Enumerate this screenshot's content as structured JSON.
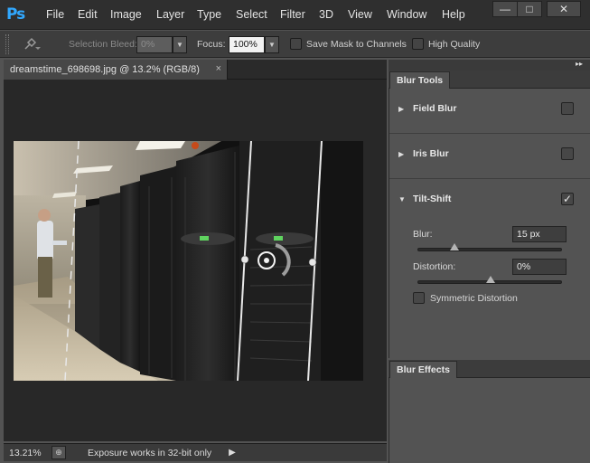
{
  "app": {
    "logo": "Ps"
  },
  "menu": [
    "File",
    "Edit",
    "Image",
    "Layer",
    "Type",
    "Select",
    "Filter",
    "3D",
    "View",
    "Window",
    "Help"
  ],
  "window_controls": {
    "minimize": "—",
    "maximize": "□",
    "close": "✕"
  },
  "options": {
    "selection_bleed_label": "Selection Bleed:",
    "selection_bleed_value": "0%",
    "focus_label": "Focus:",
    "focus_value": "100%",
    "save_mask_label": "Save Mask to Channels",
    "high_quality_label": "High Quality"
  },
  "document": {
    "tab_title": "dreamstime_698698.jpg @ 13.2% (RGB/8)",
    "tab_close": "×"
  },
  "status": {
    "zoom": "13.21%",
    "message": "Exposure works in 32-bit only"
  },
  "panel": {
    "tab_label": "Blur Tools",
    "sections": [
      {
        "title": "Field Blur",
        "checked": false
      },
      {
        "title": "Iris Blur",
        "checked": false
      },
      {
        "title": "Tilt-Shift",
        "checked": true
      }
    ],
    "blur_label": "Blur:",
    "blur_value": "15 px",
    "blur_slider": 0.25,
    "distortion_label": "Distortion:",
    "distortion_value": "0%",
    "distortion_slider": 0.5,
    "symmetric_label": "Symmetric Distortion",
    "effects_tab_label": "Blur Effects"
  },
  "colors": {
    "logo_blue": "#31a8ff",
    "panel_bg": "#535353",
    "chrome_dark": "#2f2f2f"
  }
}
